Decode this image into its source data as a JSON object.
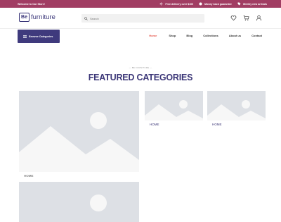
{
  "topbar": {
    "welcome": "Welcome to Our Store!",
    "promos": [
      {
        "icon": "airplane-icon",
        "text": "Free delivery over $100"
      },
      {
        "icon": "money-icon",
        "text": "Money back guarantee"
      },
      {
        "icon": "tag-icon",
        "text": "Weekly new arrivals"
      }
    ]
  },
  "header": {
    "logo_mark": "Be",
    "logo_text": "furniture",
    "search_placeholder": "Search",
    "icons": [
      "heart-icon",
      "cart-icon",
      "user-icon"
    ]
  },
  "nav": {
    "browse_label": "Browse Categories",
    "menu": [
      "Home",
      "Shop",
      "Blog",
      "Collections",
      "About us",
      "Contact"
    ],
    "active": "Home"
  },
  "section": {
    "eyebrow": "— BE FURNITURE —",
    "title": "FEATURED CATEGORIES"
  },
  "categories": [
    {
      "label": "HOME"
    },
    {
      "label": "HOME"
    },
    {
      "label": "HOME"
    },
    {
      "label": ""
    }
  ],
  "colors": {
    "topbar": "#a13d63",
    "brand": "#3c3778",
    "active_link": "#e55a4f",
    "placeholder": "#dde0e5"
  }
}
